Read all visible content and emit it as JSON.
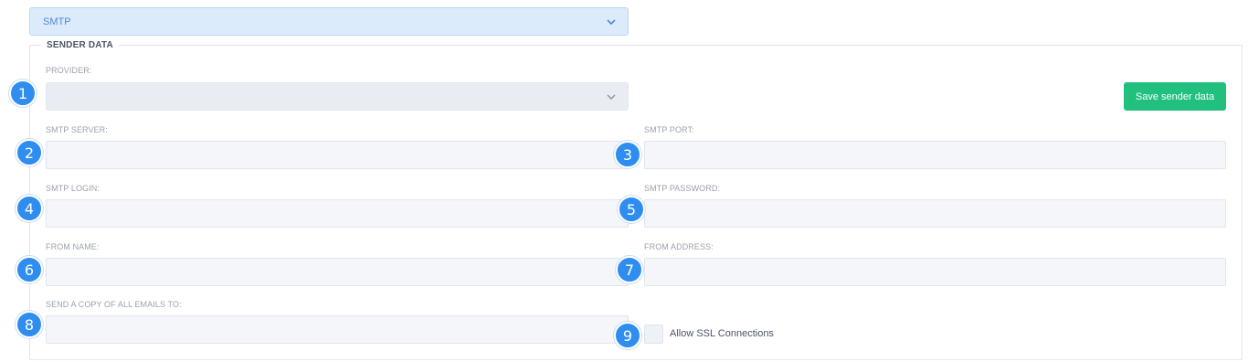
{
  "email_mode_select": {
    "value": "SMTP"
  },
  "sender": {
    "legend": "SENDER DATA",
    "provider": {
      "label": "PROVIDER:",
      "value": ""
    },
    "save_button": "Save sender data",
    "smtp_server": {
      "label": "SMTP SERVER:",
      "value": ""
    },
    "smtp_port": {
      "label": "SMTP PORT:",
      "value": ""
    },
    "smtp_login": {
      "label": "SMTP LOGIN:",
      "value": ""
    },
    "smtp_password": {
      "label": "SMTP PASSWORD:",
      "value": ""
    },
    "from_name": {
      "label": "FROM NAME:",
      "value": ""
    },
    "from_address": {
      "label": "FROM ADDRESS:",
      "value": ""
    },
    "copy_to": {
      "label": "SEND A COPY OF ALL EMAILS TO:",
      "value": ""
    },
    "ssl": {
      "label": "Allow SSL Connections",
      "checked": false
    }
  },
  "badges": [
    "1",
    "2",
    "3",
    "4",
    "5",
    "6",
    "7",
    "8",
    "9"
  ],
  "colors": {
    "accent_blue": "#2f8df0",
    "save_green": "#21c07f",
    "select_blue": "#dcebfb"
  }
}
